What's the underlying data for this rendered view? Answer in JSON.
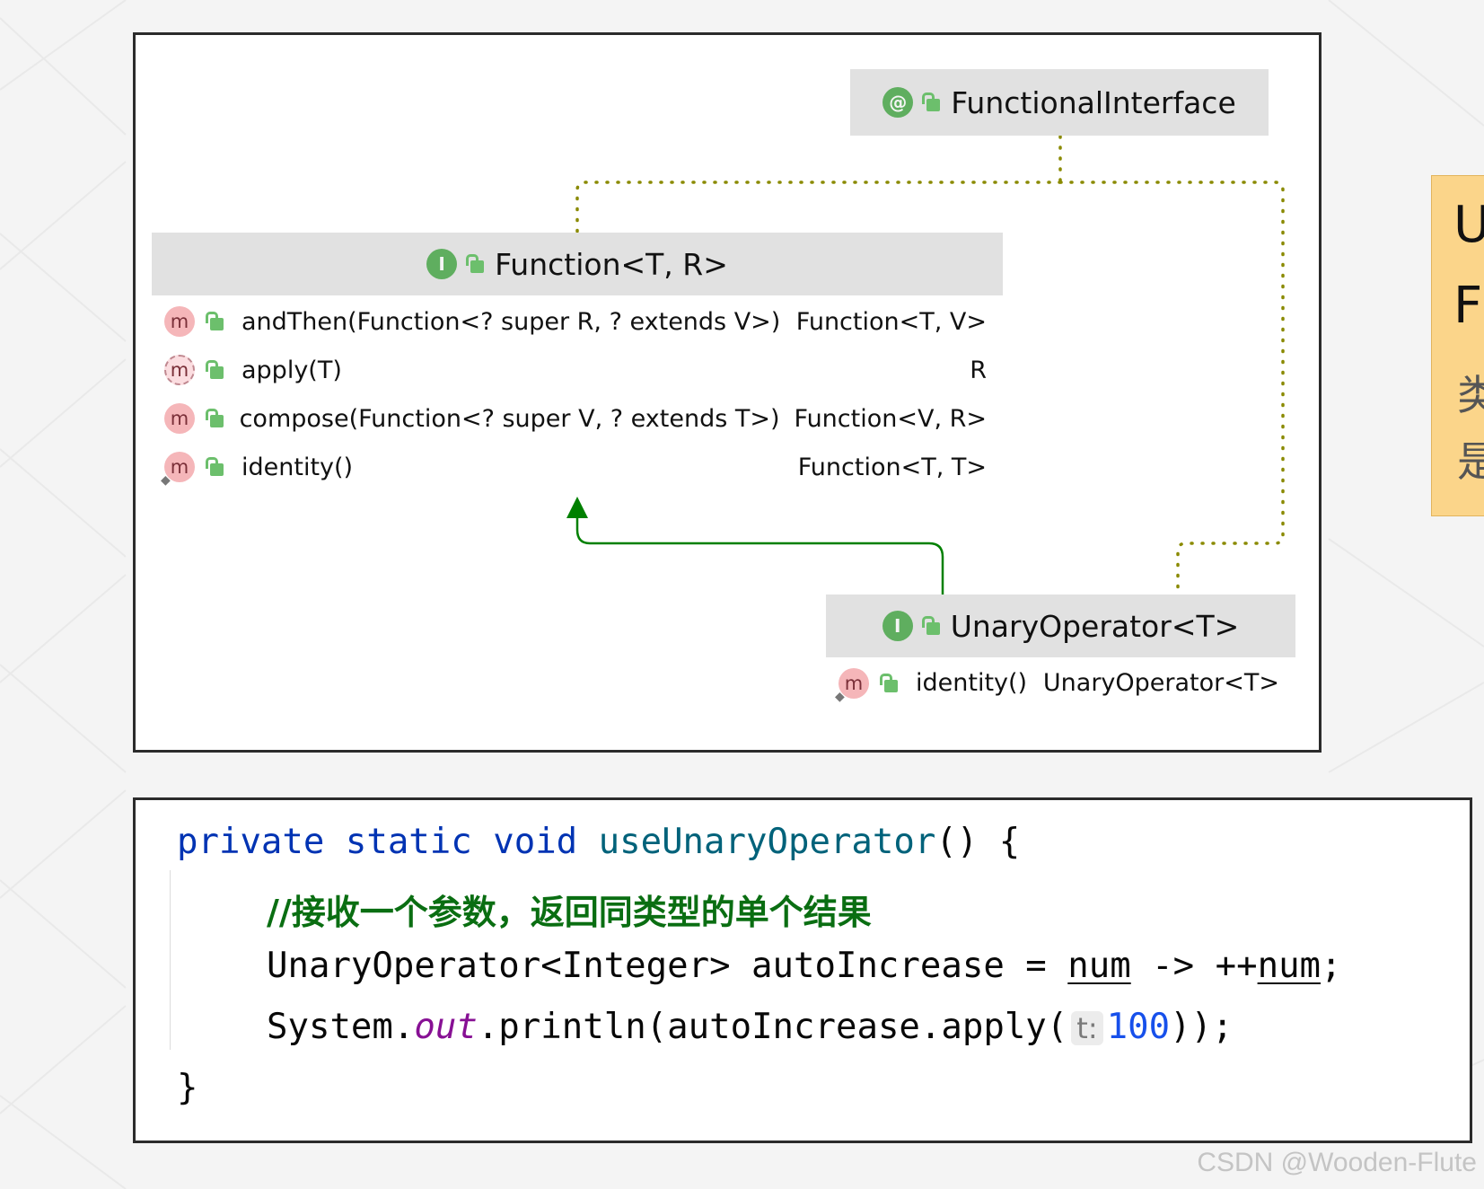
{
  "diagram": {
    "functional_interface": {
      "badge": "@",
      "title": "FunctionalInterface"
    },
    "function": {
      "badge": "I",
      "title": "Function<T, R>",
      "methods": [
        {
          "icon": "m",
          "name": "andThen(Function<? super R, ? extends V>)",
          "type": "Function<T, V>"
        },
        {
          "icon": "m",
          "name": "apply(T)",
          "type": "R"
        },
        {
          "icon": "m",
          "name": "compose(Function<? super V, ? extends T>)",
          "type": "Function<V, R>"
        },
        {
          "icon": "m",
          "name": "identity()",
          "type": "Function<T, T>"
        }
      ]
    },
    "unary_operator": {
      "badge": "I",
      "title": "UnaryOperator<T>",
      "methods": [
        {
          "icon": "m",
          "name": "identity()",
          "type": "UnaryOperator<T>"
        }
      ]
    },
    "colors": {
      "extends_arrow": "#008000",
      "annotation_link": "#8a8a00",
      "header_bg": "#e1e1e1"
    }
  },
  "code": {
    "line1": {
      "kw1": "private",
      "kw2": "static",
      "kw3": "void",
      "name": "useUnaryOperator",
      "rest": "() {"
    },
    "comment": "//接收一个参数，返回同类型的单个结果",
    "line3": {
      "decl": "UnaryOperator<Integer> autoIncrease = ",
      "param": "num",
      "arrow": " -> ++",
      "param2": "num",
      "end": ";"
    },
    "line4": {
      "pre": "System.",
      "field": "out",
      "mid": ".println(autoIncrease.apply(",
      "hint": "t:",
      "num": "100",
      "end": "));"
    },
    "close": "}"
  },
  "side_note": {
    "line1": "U",
    "line2": "F",
    "line3": "类",
    "line4": "是"
  },
  "watermark": "CSDN @Wooden-Flute"
}
